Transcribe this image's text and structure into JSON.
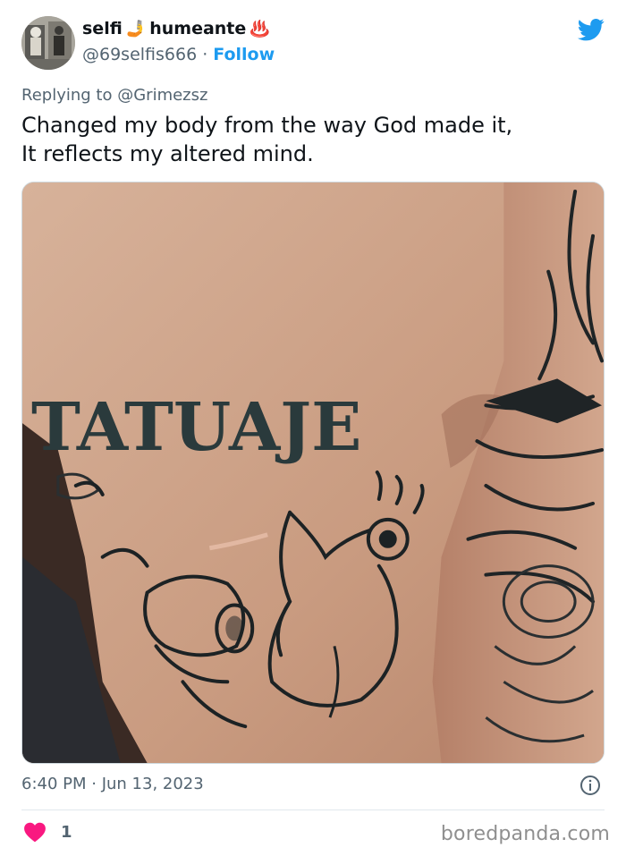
{
  "user": {
    "name_part1": "selfi",
    "name_emoji1": "🤳",
    "name_part2": "humeante",
    "name_emoji2": "♨️",
    "handle": "@69selfis666",
    "separator": "·",
    "follow_label": "Follow"
  },
  "reply": {
    "prefix": "Replying to",
    "mention": "@Grimezsz"
  },
  "tweet": {
    "line1": "Changed my body from the way God made it,",
    "line2": "It reflects my altered mind.",
    "timestamp": "6:40 PM · Jun 13, 2023",
    "like_count": "1"
  },
  "media": {
    "tattoo_text": "TATUAJE"
  },
  "watermark": "boredpanda.com",
  "colors": {
    "accent": "#1d9bf0",
    "heart": "#f91880",
    "muted": "#536471"
  },
  "icons": [
    "twitter-bird-icon",
    "info-icon",
    "heart-icon"
  ]
}
